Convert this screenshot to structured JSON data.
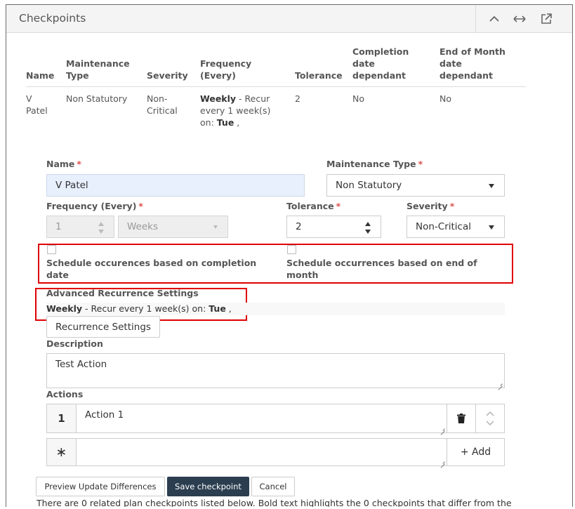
{
  "panel": {
    "title": "Checkpoints"
  },
  "header_icons": {
    "collapse": "chevron-up-icon",
    "resize": "horizontal-arrows-icon",
    "popout": "external-link-icon"
  },
  "table": {
    "headers": [
      "Name",
      "Maintenance Type",
      "Severity",
      "Frequency (Every)",
      "Tolerance",
      "Completion date dependant",
      "End of Month date dependant"
    ],
    "row": {
      "name": "V Patel",
      "maintenance_type": "Non Statutory",
      "severity": "Non-Critical",
      "frequency_bold": "Weekly",
      "frequency_rest": " - Recur every 1 week(s) on: ",
      "frequency_day": "Tue",
      "frequency_tail": " ,",
      "tolerance": "2",
      "completion_dependant": "No",
      "end_of_month_dependant": "No"
    }
  },
  "form": {
    "name_label": "Name",
    "name_value": "V Patel",
    "maintenance_type_label": "Maintenance Type",
    "maintenance_type_value": "Non Statutory",
    "frequency_label": "Frequency (Every)",
    "frequency_number": "1",
    "frequency_unit": "Weeks",
    "tolerance_label": "Tolerance",
    "tolerance_value": "2",
    "severity_label": "Severity",
    "severity_value": "Non-Critical",
    "required_mark": "*",
    "schedule_completion_label": "Schedule occurences based on completion date",
    "schedule_end_of_month_label": "Schedule occurrences based on end of month",
    "schedule_completion_checked": false,
    "schedule_end_of_month_checked": false,
    "advanced_label": "Advanced Recurrence Settings",
    "advanced_bold": "Weekly",
    "advanced_rest": " - Recur every 1 week(s) on: ",
    "advanced_day": "Tue",
    "advanced_tail": " ,",
    "recurrence_button": "Recurrence Settings",
    "description_label": "Description",
    "description_value": "Test Action",
    "actions_label": "Actions",
    "action_index": "1",
    "action_value": "Action 1",
    "new_action_marker": "∗",
    "add_button": "+ Add"
  },
  "footer": {
    "preview_button": "Preview Update Differences",
    "save_button": "Save checkpoint",
    "cancel_button": "Cancel",
    "note": "There are 0 related plan checkpoints listed below. Bold text highlights the 0 checkpoints that differ from the"
  },
  "colors": {
    "highlight": "#e00000",
    "primary": "#2b3e50",
    "required": "#d9534f",
    "autofill": "#e8f0fe"
  }
}
